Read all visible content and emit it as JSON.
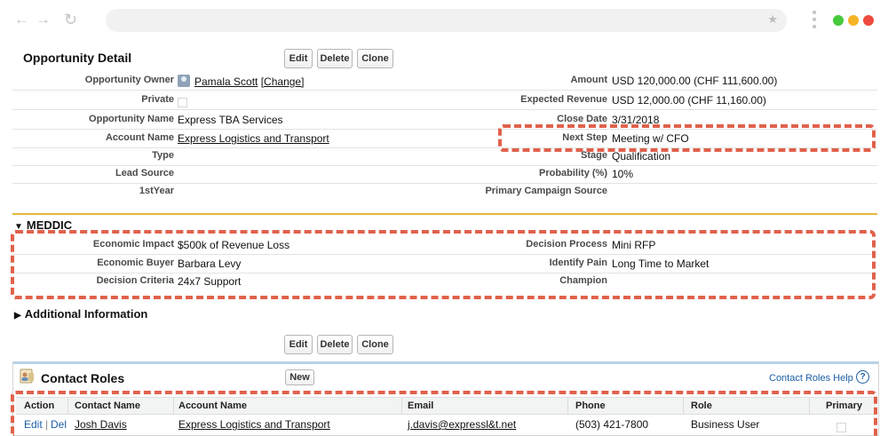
{
  "browser": {
    "icons": [
      "back-arrow-icon",
      "forward-arrow-icon",
      "reload-icon",
      "star-icon",
      "kebab-menu-icon"
    ],
    "dots": {
      "green": "#46c93a",
      "yellow": "#f5b526",
      "red": "#ee4b3e"
    }
  },
  "detail": {
    "title": "Opportunity Detail",
    "buttons": {
      "edit": "Edit",
      "delete": "Delete",
      "clone": "Clone"
    },
    "left": [
      {
        "label": "Opportunity Owner",
        "value": "Pamala Scott",
        "change": "[Change]"
      },
      {
        "label": "Private",
        "value": ""
      },
      {
        "label": "Opportunity Name",
        "value": "Express TBA Services"
      },
      {
        "label": "Account Name",
        "value": "Express Logistics and Transport"
      },
      {
        "label": "Type",
        "value": ""
      },
      {
        "label": "Lead Source",
        "value": ""
      },
      {
        "label": "1stYear",
        "value": ""
      }
    ],
    "right": [
      {
        "label": "Amount",
        "value": "USD 120,000.00 (CHF 111,600.00)"
      },
      {
        "label": "Expected Revenue",
        "value": "USD 12,000.00 (CHF 11,160.00)"
      },
      {
        "label": "Close Date",
        "value": "3/31/2018"
      },
      {
        "label": "Next Step",
        "value": "Meeting w/ CFO"
      },
      {
        "label": "Stage",
        "value": "Qualification"
      },
      {
        "label": "Probability (%)",
        "value": "10%"
      },
      {
        "label": "Primary Campaign Source",
        "value": ""
      }
    ]
  },
  "meddic": {
    "title": "MEDDIC",
    "left": [
      {
        "label": "Economic Impact",
        "value": "$500k of Revenue Loss"
      },
      {
        "label": "Economic Buyer",
        "value": "Barbara Levy"
      },
      {
        "label": "Decision Criteria",
        "value": "24x7 Support"
      }
    ],
    "right": [
      {
        "label": "Decision Process",
        "value": "Mini RFP"
      },
      {
        "label": "Identify Pain",
        "value": "Long Time to Market"
      },
      {
        "label": "Champion",
        "value": ""
      }
    ]
  },
  "additional": {
    "title": "Additional Information"
  },
  "bottom_buttons": {
    "edit": "Edit",
    "delete": "Delete",
    "clone": "Clone"
  },
  "contact_roles": {
    "title": "Contact Roles",
    "new_label": "New",
    "help_label": "Contact Roles Help",
    "help_glyph": "?",
    "columns": [
      "Action",
      "Contact Name",
      "Account Name",
      "Email",
      "Phone",
      "Role",
      "Primary"
    ],
    "rows": [
      {
        "edit": "Edit",
        "sep": "|",
        "del": "Del",
        "contact": "Josh Davis",
        "account": "Express Logistics and Transport",
        "email": "j.davis@expressl&t.net",
        "phone": "(503) 421-7800",
        "role": "Business User"
      }
    ]
  },
  "colors": {
    "highlight": "#e0614b",
    "section_rule": "#e2b93b",
    "link": "#1a5fa5"
  }
}
